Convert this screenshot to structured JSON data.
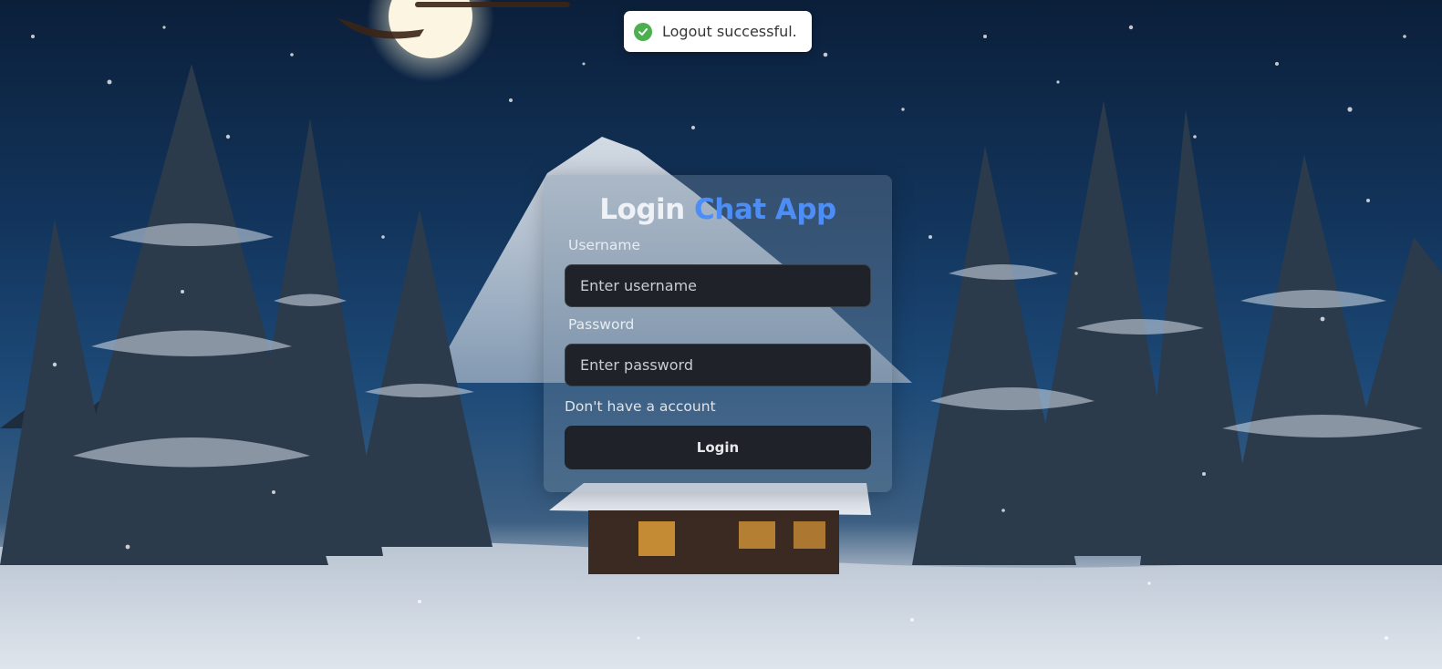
{
  "toast": {
    "message": "Logout successful.",
    "icon": "check-circle-icon",
    "icon_color": "#4caf50"
  },
  "login": {
    "title_prefix": "Login",
    "title_accent": "Chat App",
    "accent_color": "#4d8df6",
    "username_label": "Username",
    "username_placeholder": "Enter username",
    "password_label": "Password",
    "password_placeholder": "Enter password",
    "signup_link": "Don't have a account",
    "submit_label": "Login"
  }
}
